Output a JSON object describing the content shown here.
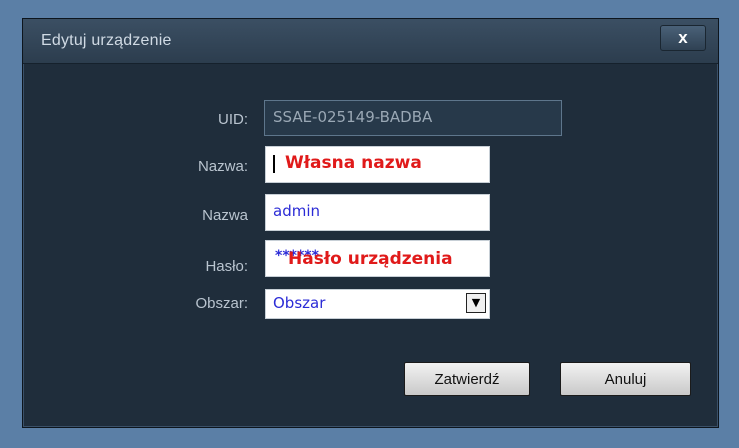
{
  "window": {
    "title": "Edytuj urządzenie",
    "close_label": "x"
  },
  "form": {
    "uid": {
      "label": "UID:",
      "value": "SSAE-025149-BADBA"
    },
    "name": {
      "label": "Nazwa:",
      "value": "Własna nazwa"
    },
    "username": {
      "label": "Nazwa",
      "value": "admin"
    },
    "password": {
      "label": "Hasło:",
      "mask": "******",
      "value": "Hasło urządzenia"
    },
    "area": {
      "label": "Obszar:",
      "selected": "Obszar",
      "arrow": "▼"
    }
  },
  "buttons": {
    "confirm": "Zatwierdź",
    "cancel": "Anuluj"
  }
}
